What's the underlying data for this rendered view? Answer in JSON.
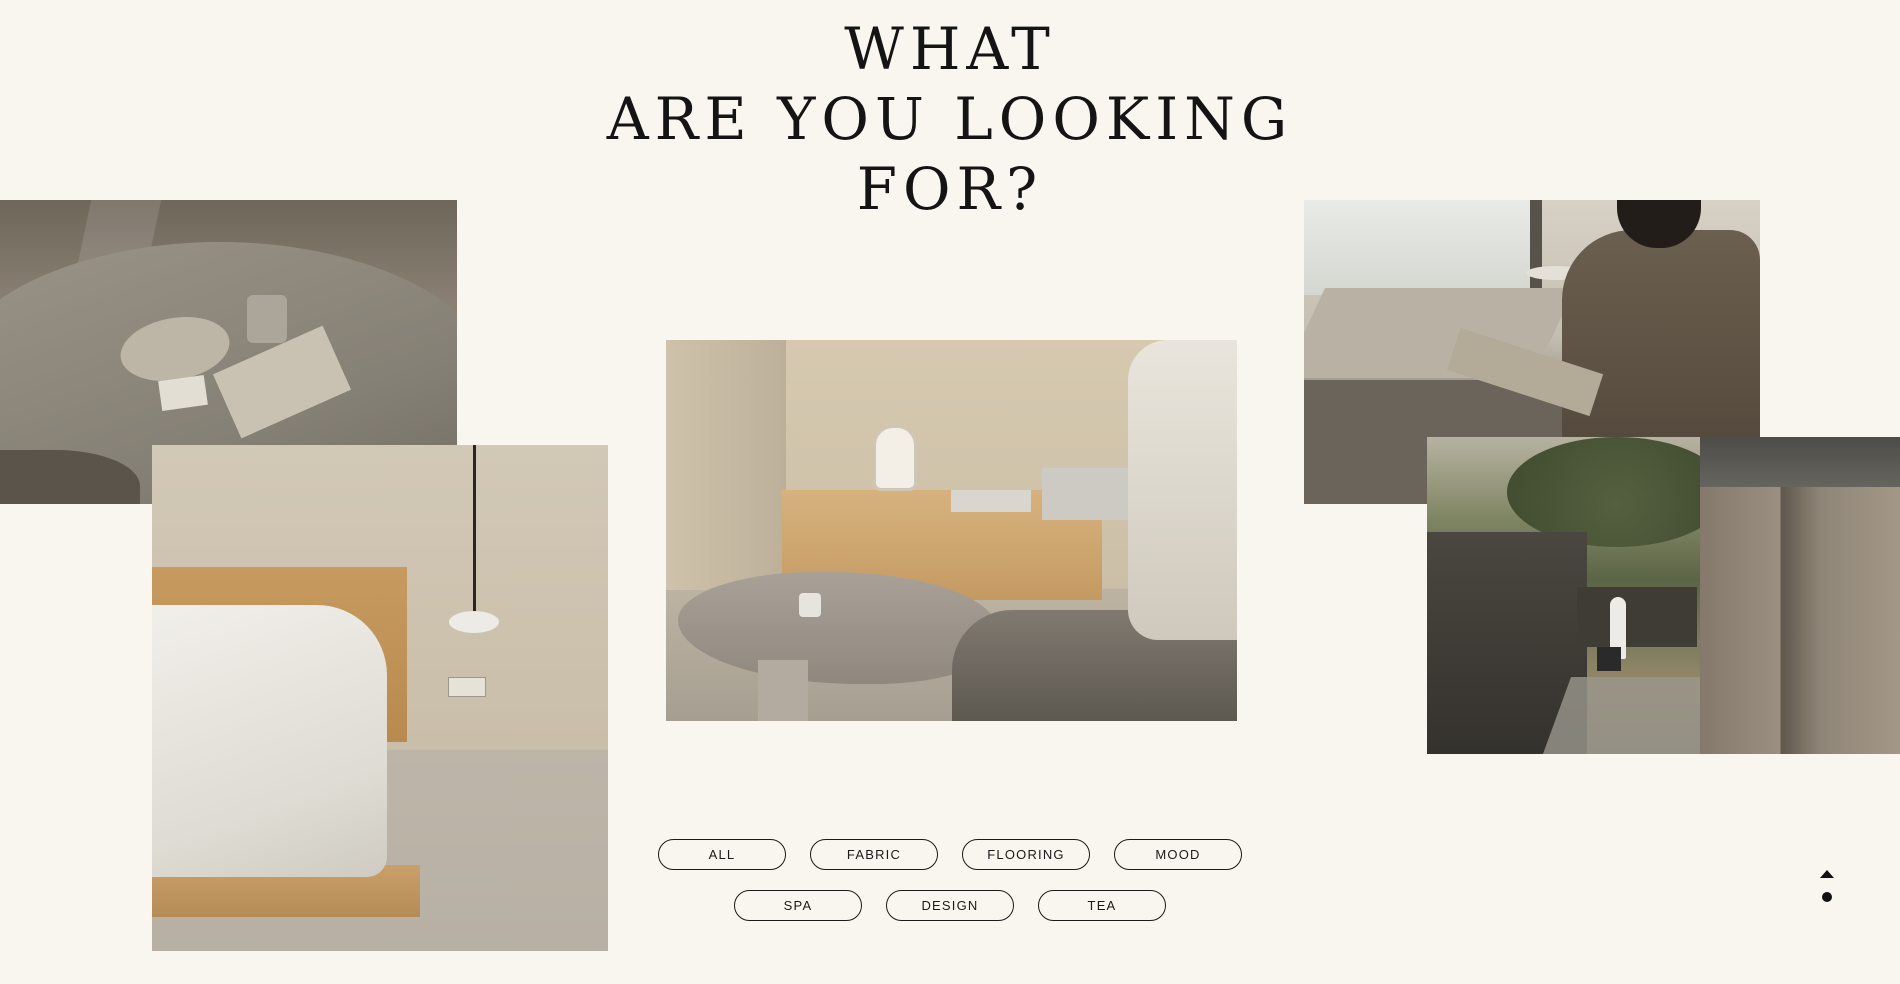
{
  "headline": {
    "line1": "WHAT",
    "line2": "ARE YOU LOOKING",
    "line3": "FOR?"
  },
  "filters": {
    "row1": [
      "ALL",
      "FABRIC",
      "FLOORING",
      "MOOD"
    ],
    "row2": [
      "SPA",
      "DESIGN",
      "TEA"
    ]
  },
  "icons": {
    "scroll_top": "chevron-up-icon"
  },
  "colors": {
    "background": "#f8f6ee",
    "text": "#141414"
  }
}
